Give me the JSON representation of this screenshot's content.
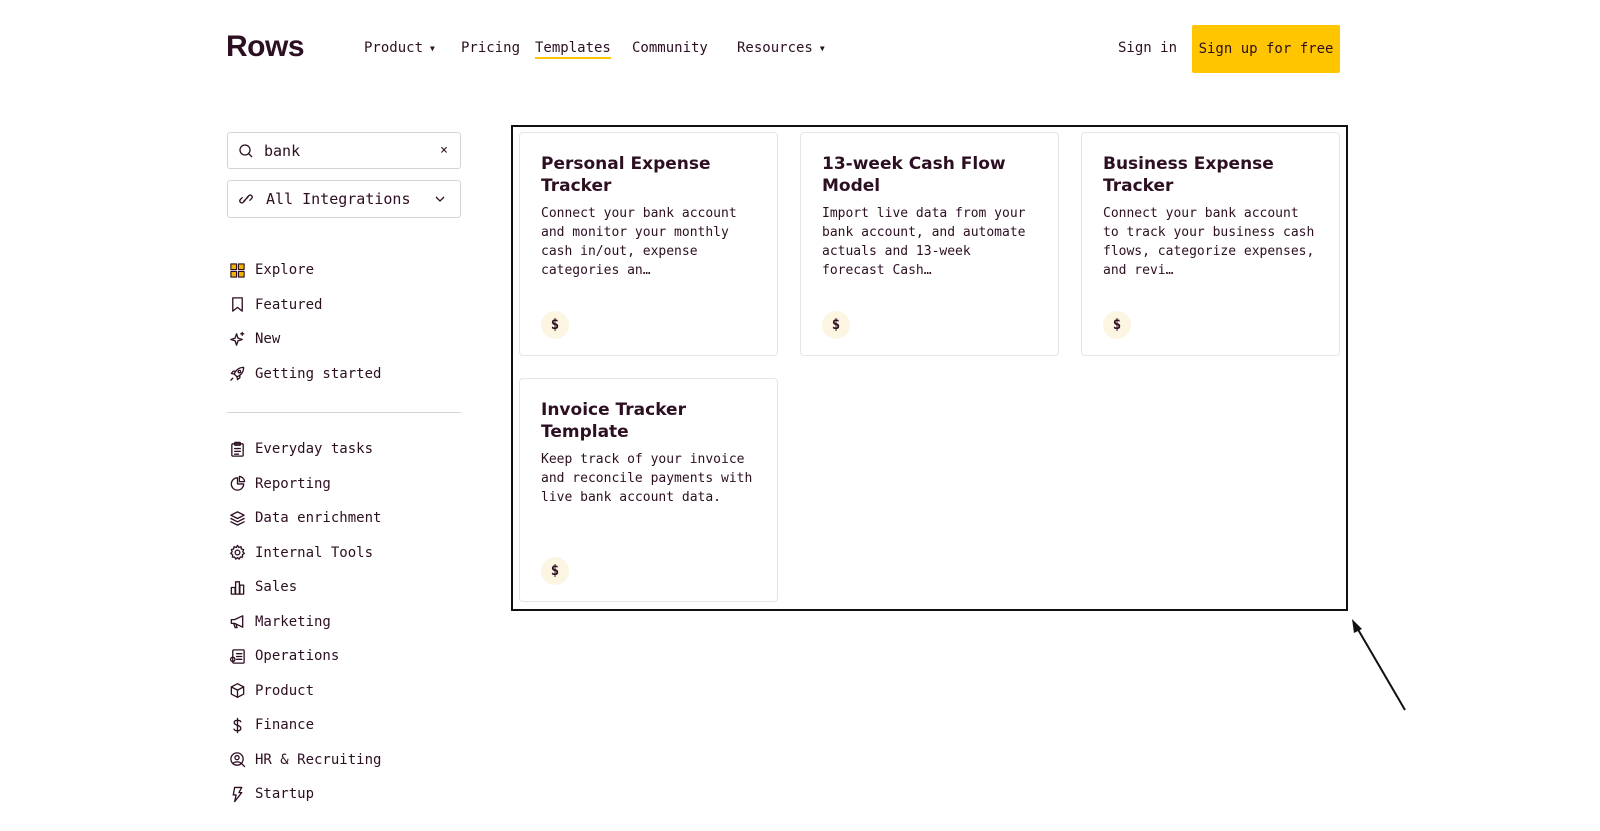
{
  "header": {
    "logo": "Rows",
    "nav": [
      {
        "label": "Product",
        "has_caret": true
      },
      {
        "label": "Pricing",
        "has_caret": false
      },
      {
        "label": "Templates",
        "has_caret": false,
        "active": true
      },
      {
        "label": "Community",
        "has_caret": false
      },
      {
        "label": "Resources",
        "has_caret": true
      }
    ],
    "signin": "Sign in",
    "signup": "Sign up for free"
  },
  "sidebar": {
    "search_value": "bank",
    "clear_glyph": "×",
    "integrations_value": "All Integrations",
    "primary": [
      {
        "label": "Explore",
        "icon": "grid-icon"
      },
      {
        "label": "Featured",
        "icon": "bookmark-icon"
      },
      {
        "label": "New",
        "icon": "sparkle-icon"
      },
      {
        "label": "Getting started",
        "icon": "rocket-icon"
      }
    ],
    "categories": [
      {
        "label": "Everyday tasks",
        "icon": "clipboard-icon"
      },
      {
        "label": "Reporting",
        "icon": "pie-chart-icon"
      },
      {
        "label": "Data enrichment",
        "icon": "layers-icon"
      },
      {
        "label": "Internal Tools",
        "icon": "gear-icon"
      },
      {
        "label": "Sales",
        "icon": "bar-chart-icon"
      },
      {
        "label": "Marketing",
        "icon": "megaphone-icon"
      },
      {
        "label": "Operations",
        "icon": "operations-icon"
      },
      {
        "label": "Product",
        "icon": "cube-icon"
      },
      {
        "label": "Finance",
        "icon": "dollar-icon"
      },
      {
        "label": "HR & Recruiting",
        "icon": "person-search-icon"
      },
      {
        "label": "Startup",
        "icon": "bolt-icon"
      }
    ]
  },
  "results": [
    {
      "title": "Personal Expense Tracker",
      "description": "Connect your bank account and monitor your monthly cash in/out, expense categories an…",
      "badge": "$"
    },
    {
      "title": "13-week Cash Flow Model",
      "description": "Import live data from your bank account, and automate actuals and 13-week forecast Cash…",
      "badge": "$"
    },
    {
      "title": "Business Expense Tracker",
      "description": "Connect your bank account to track your business cash flows, categorize expenses, and revi…",
      "badge": "$"
    },
    {
      "title": "Invoice Tracker Template",
      "description": "Keep track of your invoice and reconcile payments with live bank account data.",
      "badge": "$"
    }
  ],
  "colors": {
    "accent": "#ffc600",
    "text": "#2d0f22",
    "explore_icon": "#f2b200"
  }
}
